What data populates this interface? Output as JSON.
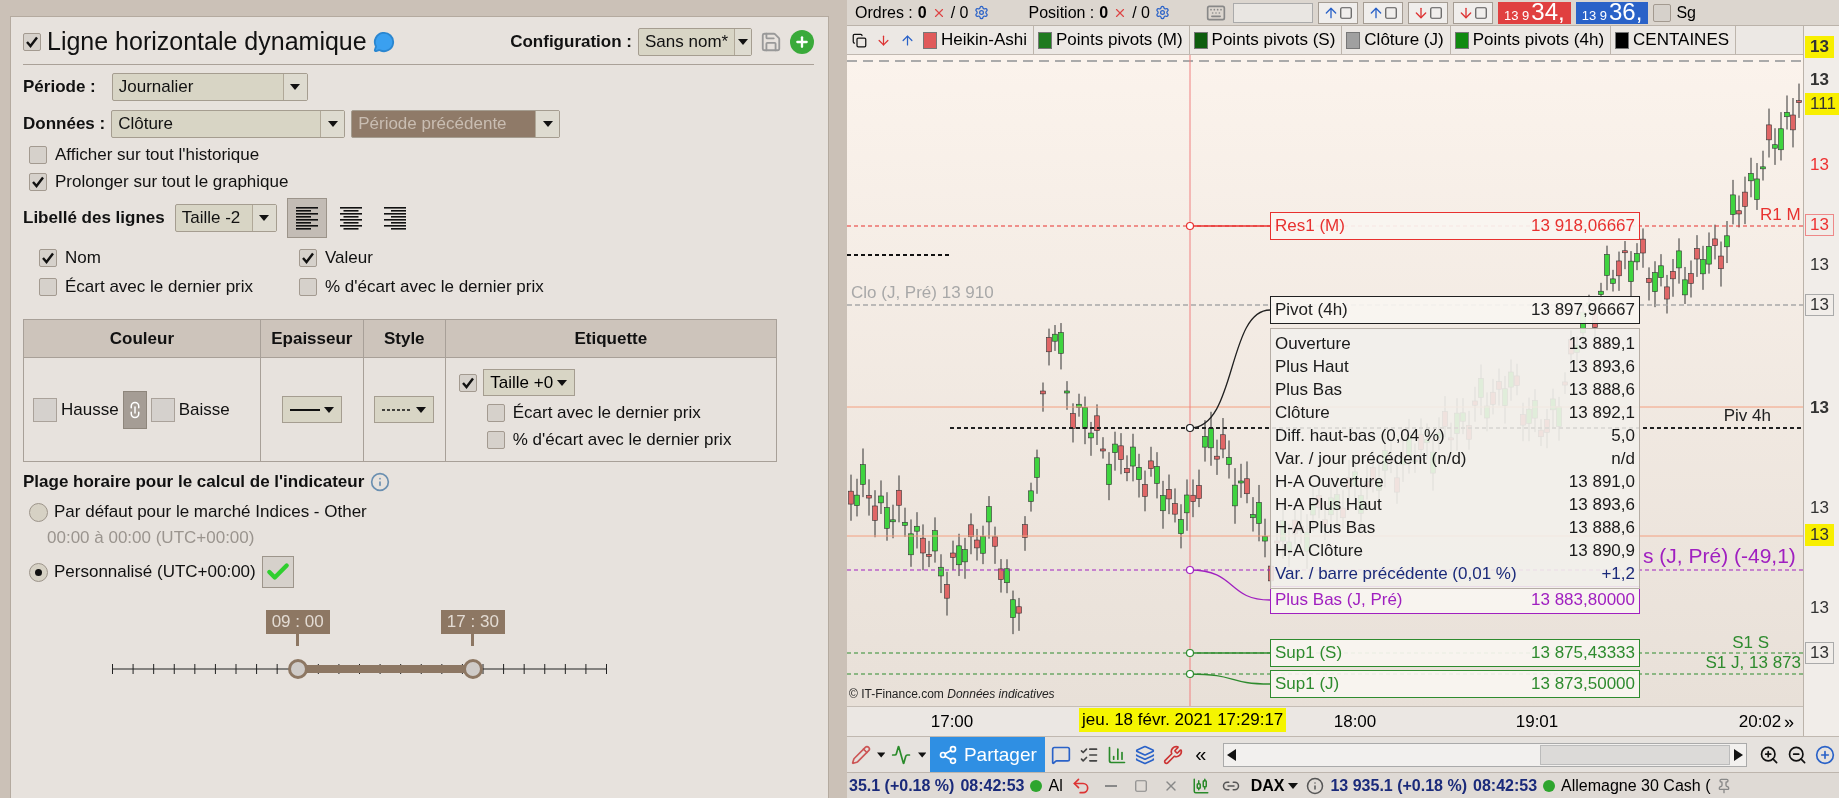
{
  "dialog": {
    "title": {
      "text": "Ligne horizontale dynamique",
      "checked": true
    },
    "configuration": {
      "label": "Configuration :",
      "value": "Sans nom*"
    },
    "period": {
      "label": "Période :",
      "value": "Journalier"
    },
    "data": {
      "label": "Données :",
      "value": "Clôture",
      "mode": "Période précédente"
    },
    "options": [
      {
        "label": "Afficher sur tout l'historique",
        "checked": false
      },
      {
        "label": "Prolonger sur tout le graphique",
        "checked": true
      }
    ],
    "line_labels": {
      "label": "Libellé des lignes",
      "size": "Taille -2",
      "alignments": [
        {
          "kind": "left",
          "selected": true
        },
        {
          "kind": "center",
          "selected": false
        },
        {
          "kind": "right",
          "selected": false
        }
      ],
      "fields": [
        {
          "label": "Nom",
          "checked": true
        },
        {
          "label": "Valeur",
          "checked": true
        },
        {
          "label": "Écart avec le dernier prix",
          "checked": false
        },
        {
          "label": "% d'écart avec le dernier prix",
          "checked": false
        }
      ]
    },
    "style_table": {
      "columns": [
        "Couleur",
        "Epaisseur",
        "Style",
        "Etiquette"
      ],
      "rise": "Hausse",
      "fall": "Baisse",
      "linked": true,
      "label_checked": true,
      "label_size": "Taille +0",
      "label_options": [
        {
          "label": "Écart avec le dernier prix",
          "checked": false
        },
        {
          "label": "% d'écart avec le dernier prix",
          "checked": false
        }
      ]
    },
    "time_range": {
      "title": "Plage horaire pour le calcul de l'indicateur",
      "choices": [
        {
          "label": "Par défaut pour le marché Indices - Other",
          "note": "00:00 à 00:00 (UTC+00:00)",
          "selected": false
        },
        {
          "label": "Personnalisé (UTC+00:00)",
          "selected": true
        }
      ],
      "handles": [
        {
          "label": "09 : 00",
          "level": 0.375
        },
        {
          "label": "17 : 30",
          "level": 0.729
        }
      ]
    }
  },
  "chart": {
    "top_bar": {
      "orders": {
        "label": "Ordres :",
        "value": "0",
        "total": "/ 0"
      },
      "position": {
        "label": "Position :",
        "value": "0",
        "total": "/ 0"
      },
      "quotes": [
        {
          "kind": "sell",
          "small": "13 9",
          "big": "34,"
        },
        {
          "kind": "buy",
          "small": "13 9",
          "big": "36,"
        }
      ],
      "option": {
        "label": "Sg",
        "checked": false
      }
    },
    "tabs": [
      {
        "label": "Heikin-Ashi",
        "color": "#e05a5a"
      },
      {
        "label": "Points pivots (M)",
        "color": "#1f7a1f"
      },
      {
        "label": "Points pivots (S)",
        "color": "#0d5c0d"
      },
      {
        "label": "Clôture (J)",
        "color": "#a0a0a0"
      },
      {
        "label": "Points pivots (4h)",
        "color": "#108a10"
      },
      {
        "label": "CENTAINES",
        "color": "#000000"
      }
    ],
    "levels": [
      {
        "label": "Res1 (M)",
        "value": "13 918,06667",
        "color": "#e8312f"
      },
      {
        "label": "Pivot (4h)",
        "value": "13 897,96667",
        "color": "#202020"
      },
      {
        "label": "Plus Bas (J, Pré)",
        "value": "13 883,80000",
        "color": "#a020c0"
      },
      {
        "label": "Sup1 (S)",
        "value": "13 875,43333",
        "color": "#2e8b2e"
      },
      {
        "label": "Sup1 (J)",
        "value": "13 873,50000",
        "color": "#2e8b2e"
      }
    ],
    "line_tags": [
      {
        "text": "R1 M",
        "color": "#e8312f"
      },
      {
        "text": "Clo (J, Pré) 13 910",
        "color": "#a8a8a8"
      },
      {
        "text": "Piv 4h",
        "color": "#202020"
      },
      {
        "text": "s (J, Pré) (-49,1)",
        "color": "#a020c0"
      },
      {
        "text": "S1 S",
        "color": "#2e8b2e"
      },
      {
        "text": "S1 J, 13 873",
        "color": "#2e8b2e"
      }
    ],
    "tooltip": [
      {
        "label": "Ouverture",
        "value": "13 889,1",
        "kind": "plain"
      },
      {
        "label": "Plus Haut",
        "value": "13 893,6",
        "kind": "plain"
      },
      {
        "label": "Plus Bas",
        "value": "13 888,6",
        "kind": "plain"
      },
      {
        "label": "Clôture",
        "value": "13 892,1",
        "kind": "plain"
      },
      {
        "label": "Diff. haut-bas (0,04 %)",
        "value": "5,0",
        "kind": "plain"
      },
      {
        "label": "Var. / jour précédent (n/d)",
        "value": "n/d",
        "kind": "plain"
      },
      {
        "label": "H-A Ouverture",
        "value": "13 891,0",
        "kind": "plain"
      },
      {
        "label": "H-A Plus Haut",
        "value": "13 893,6",
        "kind": "plain"
      },
      {
        "label": "H-A Plus Bas",
        "value": "13 888,6",
        "kind": "plain"
      },
      {
        "label": "H-A Clôture",
        "value": "13 890,9",
        "kind": "plain"
      },
      {
        "label": "Var. / barre précédente (0,01 %)",
        "value": "+1,2",
        "kind": "change"
      }
    ],
    "credit": {
      "source": "© IT-Finance.com",
      "note": "Données indicatives"
    },
    "price_axis": [
      {
        "text": "13",
        "kind": "highlight"
      },
      {
        "text": "13",
        "kind": "bold"
      },
      {
        "text": "111",
        "kind": "yellow"
      },
      {
        "text": "13",
        "kind": "red"
      },
      {
        "text": "13",
        "kind": "redboxed"
      },
      {
        "text": "13",
        "kind": "plain"
      },
      {
        "text": "13",
        "kind": "boxed"
      },
      {
        "text": "13",
        "kind": "bold"
      },
      {
        "text": "13",
        "kind": "plain"
      },
      {
        "text": "13",
        "kind": "yellow"
      },
      {
        "text": "13",
        "kind": "plain"
      },
      {
        "text": "13",
        "kind": "boxed"
      }
    ],
    "time_axis": {
      "labels": [
        "17:00",
        "18:00",
        "19:01",
        "20:02"
      ],
      "cursor": "jeu. 18 févr. 2021 17:29:17",
      "more": "»"
    },
    "toolbar": {
      "share": "Partager",
      "back": "«"
    },
    "status_bar": {
      "left_quote": "35.1 (+0.18 %)",
      "left_time": "08:42:53",
      "left_name": "Al",
      "symbol": "DAX",
      "right_quote": "13 935.1 (+0.18 %)",
      "right_time": "08:42:53",
      "right_name": "Allemagne 30 Cash ("
    }
  }
}
